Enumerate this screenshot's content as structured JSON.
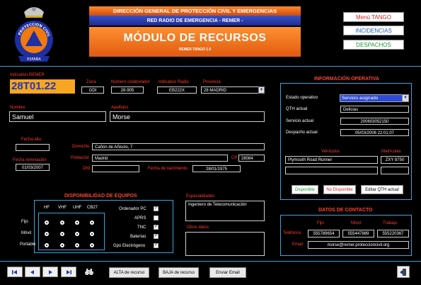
{
  "header": {
    "line1": "DIRECCIÓN GENERAL DE PROTECCIÓN CIVIL Y EMERGENCIAS",
    "line2": "RED RADIO DE EMERGENCIA - REMER -",
    "module_title": "MÓDULO DE RECURSOS",
    "version": "REMER TANGO 1.0"
  },
  "logo": {
    "text_top": "PROTECCION CIVIL",
    "text_bottom": "ESPAÑA"
  },
  "menu": {
    "tango": "Menú TANGO",
    "incidencias": "INCIDENCIAS",
    "despachos": "DESPACHOS"
  },
  "identity": {
    "indicativo_label": "Indicativo REMER",
    "indicativo_value": "28T01.22",
    "zona_label": "Zona",
    "zona_value": "GDI",
    "colaborador_label": "Número colaborador",
    "colaborador_value": "28-905",
    "radio_label": "Indicativo Radio",
    "radio_value": "EB222X",
    "provincia_label": "Provincia",
    "provincia_value": "28 MADRID",
    "nombre_label": "Nombre",
    "nombre_value": "Samuel",
    "apellidos_label": "Apellidos",
    "apellidos_value": "Morse"
  },
  "dates": {
    "alta_label": "Fecha alta",
    "alta_value": "",
    "renovacion_label": "Fecha renovación",
    "renovacion_value": "01/03/2007"
  },
  "address": {
    "domicilio_label": "Domicilio",
    "domicilio_value": "Cañón de Añisclo, 7",
    "poblacion_label": "Población",
    "poblacion_value": "Madrid",
    "cp_label": "CP",
    "cp_value": "28084",
    "dni_label": "DNI",
    "dni_value": "",
    "nacimiento_label": "Fecha de nacimiento",
    "nacimiento_value": "28/01/1975"
  },
  "operativa": {
    "title": "INFORMACIÓN OPERATIVA",
    "estado_label": "Estado operativo",
    "estado_value": "Servicio asignado",
    "qth_label": "QTH actual",
    "qth_value": "Delicias",
    "servicio_label": "Servicio actual",
    "servicio_value": "200603052150",
    "despacho_label": "Despacho actual",
    "despacho_value": "05/03/2006 22:01:07",
    "vehiculos_label": "Vehículos",
    "matriculas_label": "Matrículas",
    "vehiculo1": "Plymouth Road Runner",
    "matricula1": "ZXY 8750",
    "vehiculo2": "",
    "matricula2": "",
    "btn_disponible": "Disponible",
    "btn_no_disponible": "No Disponible",
    "btn_editar_qth": "Editar QTH actual"
  },
  "equipos": {
    "title": "DISPONIBILIDAD DE EQUIPOS",
    "cols": [
      "HF",
      "VHF",
      "UHF",
      "CB27"
    ],
    "rows": [
      "Fijo",
      "Móvil",
      "Portable"
    ],
    "checks": [
      {
        "label": "Ordenador PC",
        "checked": true
      },
      {
        "label": "APRS",
        "checked": false
      },
      {
        "label": "TNC",
        "checked": true
      },
      {
        "label": "Baterías",
        "checked": true
      },
      {
        "label": "Gpo Electrógeno",
        "checked": true
      }
    ]
  },
  "especialidades": {
    "label": "Especialidades",
    "value": "Ingeniero de Telecomunicación"
  },
  "otros": {
    "label": "Otros datos",
    "value": ""
  },
  "contacto": {
    "title": "DATOS DE CONTACTO",
    "fijo_label": "Fijo",
    "movil_label": "Móvil",
    "trabajo_label": "Trabajo",
    "telefonos_label": "Teléfonos",
    "email_label": "Email",
    "fijo_value": "555789654",
    "movil_value": "555447889",
    "trabajo_value": "555220367",
    "email_value": "morse@remer.proteccioncivil.org"
  },
  "toolbar": {
    "alta_label": "ALTA de recurso",
    "baja_label": "BAJA de recurso",
    "email_label": "Enviar Email"
  },
  "colors": {
    "accent_blue": "#3aa3e0",
    "label_red": "#ff3b2e",
    "highlight_orange": "#f6a623",
    "header_blue": "#2a3aa8"
  }
}
